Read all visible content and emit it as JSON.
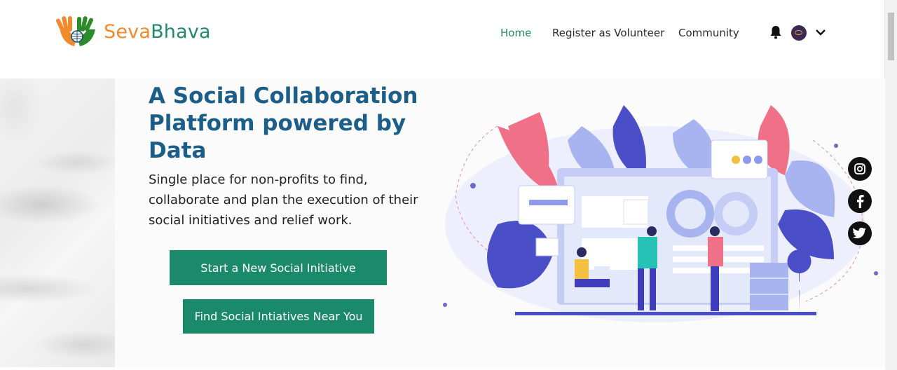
{
  "brand": {
    "name_part1": "Seva",
    "name_part2": "Bhava",
    "logo_icon": "hands-globe-icon",
    "colors": {
      "orange": "#f08a2c",
      "green": "#1f8a6e"
    }
  },
  "nav": {
    "items": [
      {
        "label": "Home",
        "active": true
      },
      {
        "label": "Register as Volunteer",
        "active": false
      },
      {
        "label": "Community",
        "active": false
      }
    ],
    "notification_icon": "bell-icon",
    "profile_icon": "avatar",
    "menu_icon": "chevron-down-icon"
  },
  "hero": {
    "headline": "A Social Collaboration Platform powered by Data",
    "subtext": "Single place for non-profits to find, collaborate and plan the execution of their social initiatives and relief work.",
    "primary_button": "Start a New Social Initiative",
    "secondary_button": "Find Social Intiatives Near You"
  },
  "social": {
    "items": [
      {
        "name": "instagram-icon"
      },
      {
        "name": "facebook-icon"
      },
      {
        "name": "twitter-icon"
      }
    ]
  },
  "colors": {
    "accent": "#1b8a6b",
    "heading": "#1b5e8a"
  }
}
